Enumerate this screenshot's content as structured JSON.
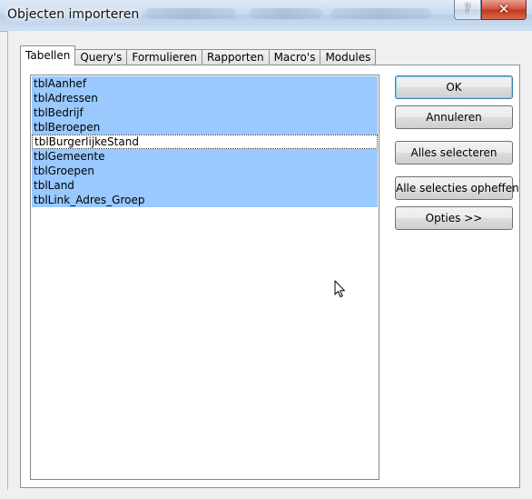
{
  "window": {
    "title": "Objecten importeren",
    "help_glyph": "?",
    "close_glyph": "✕"
  },
  "tabs": [
    {
      "label": "Tabellen",
      "active": true
    },
    {
      "label": "Query's",
      "active": false
    },
    {
      "label": "Formulieren",
      "active": false
    },
    {
      "label": "Rapporten",
      "active": false
    },
    {
      "label": "Macro's",
      "active": false
    },
    {
      "label": "Modules",
      "active": false
    }
  ],
  "list": {
    "items": [
      {
        "label": "tblAanhef",
        "selected": true
      },
      {
        "label": "tblAdressen",
        "selected": true
      },
      {
        "label": "tblBedrijf",
        "selected": true
      },
      {
        "label": "tblBeroepen",
        "selected": true
      },
      {
        "label": "tblBurgerlijkeStand",
        "selected": false,
        "focused": true
      },
      {
        "label": "tblGemeente",
        "selected": true
      },
      {
        "label": "tblGroepen",
        "selected": true
      },
      {
        "label": "tblLand",
        "selected": true
      },
      {
        "label": "tblLink_Adres_Groep",
        "selected": true
      }
    ]
  },
  "buttons": {
    "ok": "OK",
    "cancel": "Annuleren",
    "select_all": "Alles selecteren",
    "deselect_all": "Alle selecties opheffen",
    "options": "Opties >>"
  },
  "colors": {
    "selection": "#99c9ff",
    "titlebar": "#c9daee",
    "close_button": "#c0371c"
  }
}
